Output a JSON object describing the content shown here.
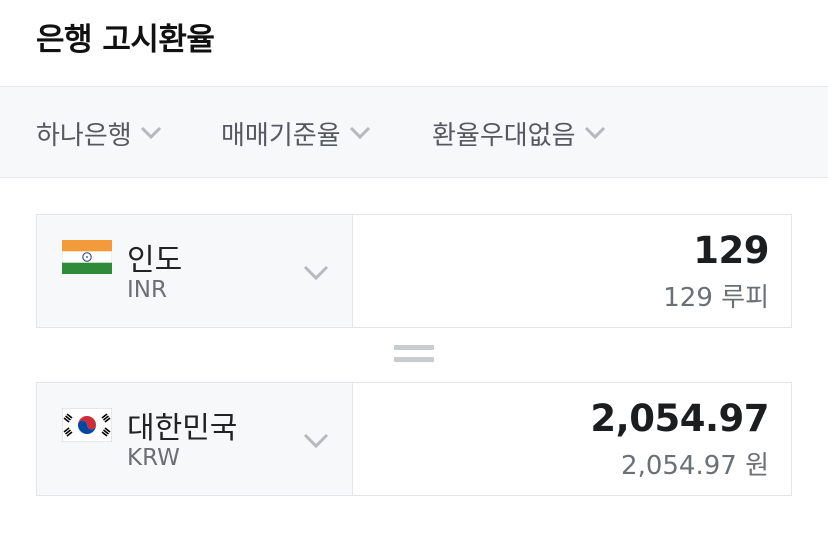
{
  "header": {
    "title": "은행 고시환율"
  },
  "filters": [
    {
      "label": "하나은행",
      "icon": "chevron-down-icon"
    },
    {
      "label": "매매기준율",
      "icon": "chevron-down-icon"
    },
    {
      "label": "환율우대없음",
      "icon": "chevron-down-icon"
    }
  ],
  "from_currency": {
    "name": "인도",
    "code": "INR",
    "flag": "india-flag-icon",
    "amount": "129",
    "amount_text": "129 루피"
  },
  "equals_icon": "equals-icon",
  "to_currency": {
    "name": "대한민국",
    "code": "KRW",
    "flag": "korea-flag-icon",
    "amount": "2,054.97",
    "amount_text": "2,054.97 원"
  },
  "colors": {
    "background": "#ffffff",
    "panel": "#f7f8fa",
    "border": "#e3e5e8",
    "text_primary": "#1b1d1f",
    "text_secondary": "#6b7075"
  }
}
